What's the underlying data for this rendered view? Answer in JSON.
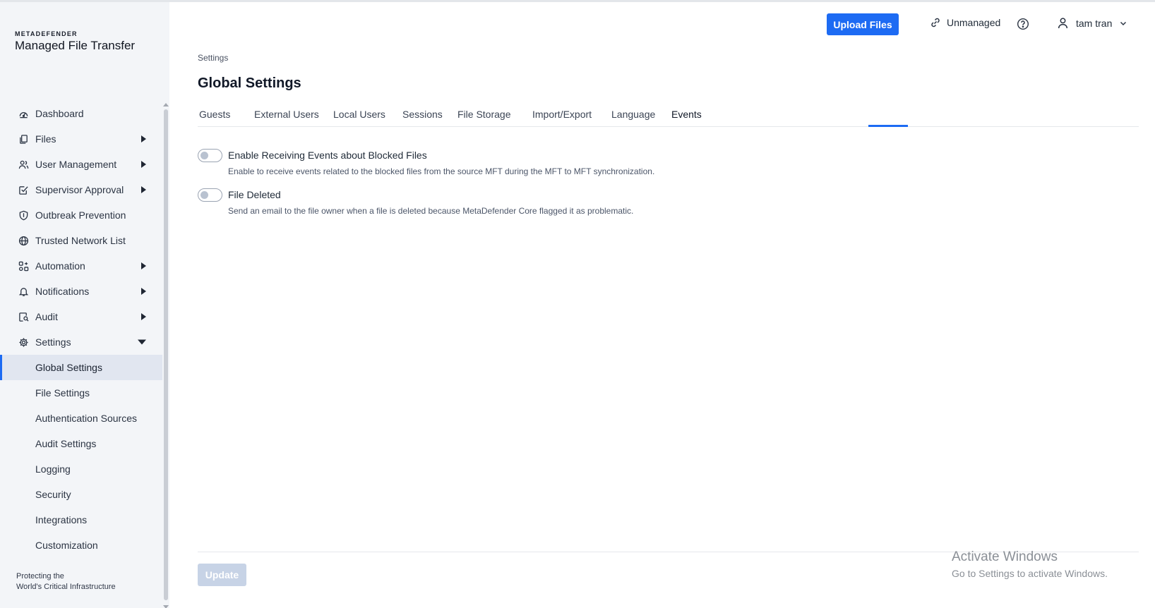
{
  "brand": {
    "top": "METADEFENDER",
    "name": "Managed File Transfer"
  },
  "sidebar": {
    "items": [
      {
        "label": "Dashboard",
        "icon": "dashboard-icon",
        "arrow": ""
      },
      {
        "label": "Files",
        "icon": "files-icon",
        "arrow": "right"
      },
      {
        "label": "User Management",
        "icon": "users-icon",
        "arrow": "right"
      },
      {
        "label": "Supervisor Approval",
        "icon": "approval-icon",
        "arrow": "right"
      },
      {
        "label": "Outbreak Prevention",
        "icon": "shield-icon",
        "arrow": ""
      },
      {
        "label": "Trusted Network List",
        "icon": "globe-icon",
        "arrow": ""
      },
      {
        "label": "Automation",
        "icon": "automation-icon",
        "arrow": "right"
      },
      {
        "label": "Notifications",
        "icon": "bell-icon",
        "arrow": "right"
      },
      {
        "label": "Audit",
        "icon": "audit-icon",
        "arrow": "right"
      },
      {
        "label": "Settings",
        "icon": "gear-icon",
        "arrow": "down"
      }
    ],
    "sub_items": [
      {
        "label": "Global Settings",
        "active": true
      },
      {
        "label": "File Settings",
        "active": false
      },
      {
        "label": "Authentication Sources",
        "active": false
      },
      {
        "label": "Audit Settings",
        "active": false
      },
      {
        "label": "Logging",
        "active": false
      },
      {
        "label": "Security",
        "active": false
      },
      {
        "label": "Integrations",
        "active": false
      },
      {
        "label": "Customization",
        "active": false
      }
    ],
    "footer_line1": "Protecting the",
    "footer_line2": "World's Critical Infrastructure"
  },
  "header": {
    "upload_label": "Upload Files",
    "unmanaged_label": "Unmanaged",
    "help_icon": "help-icon",
    "user_name": "tam tran"
  },
  "main": {
    "breadcrumb": "Settings",
    "title": "Global Settings",
    "tabs": [
      "Guests",
      "External Users",
      "Local Users",
      "Sessions",
      "File Storage",
      "Import/Export",
      "Language",
      "Events"
    ],
    "active_tab": "Events",
    "settings": [
      {
        "label": "Enable Receiving Events about Blocked Files",
        "description": "Enable to receive events related to the blocked files from the source MFT during the MFT to MFT synchronization.",
        "enabled": false
      },
      {
        "label": "File Deleted",
        "description": "Send an email to the file owner when a file is deleted because MetaDefender Core flagged it as problematic.",
        "enabled": false
      }
    ],
    "update_label": "Update"
  },
  "watermark": {
    "title": "Activate Windows",
    "subtitle": "Go to Settings to activate Windows."
  },
  "colors": {
    "accent": "#1d6bf3",
    "sidebar_bg": "#f3f5f8",
    "active_item_bg": "#e1e6f0",
    "disabled_button": "#c7d3e6"
  }
}
